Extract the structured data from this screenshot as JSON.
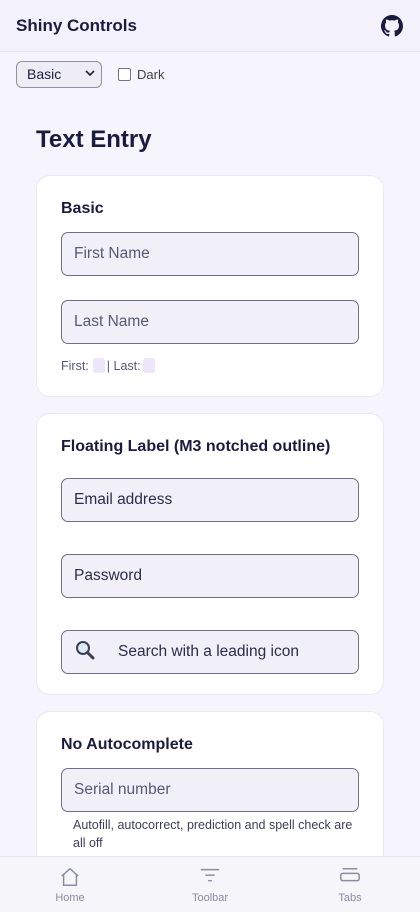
{
  "app": {
    "title": "Shiny Controls",
    "github_icon": "github-icon"
  },
  "controls": {
    "select_value": "Basic",
    "dark_label": "Dark",
    "dark_checked": false
  },
  "section": {
    "title": "Text Entry"
  },
  "cards": {
    "basic": {
      "title": "Basic",
      "first_placeholder": "First Name",
      "last_placeholder": "Last Name",
      "echo_first_label": "First:",
      "echo_sep": "| Last:"
    },
    "floating": {
      "title": "Floating Label (M3 notched outline)",
      "email_label": "Email address",
      "password_label": "Password",
      "search_label": "Search with a leading icon",
      "search_icon": "search-icon"
    },
    "noauto": {
      "title": "No Autocomplete",
      "serial_placeholder": "Serial number",
      "helper": "Autofill, autocorrect, prediction and spell check are all off"
    }
  },
  "bottom_nav": {
    "items": [
      {
        "label": "Home",
        "icon": "home-icon"
      },
      {
        "label": "Toolbar",
        "icon": "toolbar-icon"
      },
      {
        "label": "Tabs",
        "icon": "tabs-icon"
      }
    ]
  },
  "colors": {
    "accent": "#1a1c3d",
    "background": "#f6f4fd",
    "field_background": "#f1f0f9"
  }
}
